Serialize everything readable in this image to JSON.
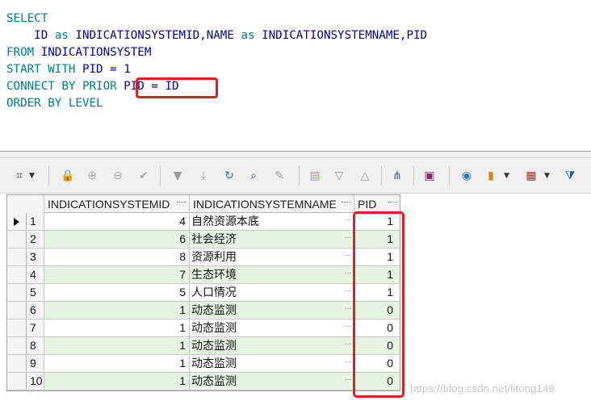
{
  "editor": {
    "lines": [
      {
        "parts": [
          {
            "t": "SELECT",
            "k": "kw"
          }
        ]
      },
      {
        "parts": [
          {
            "t": "    ",
            "k": "str"
          },
          {
            "t": "ID",
            "k": "str"
          },
          {
            "t": " as ",
            "k": "kw"
          },
          {
            "t": "INDICATIONSYSTEMID,NAME",
            "k": "str"
          },
          {
            "t": " as ",
            "k": "kw"
          },
          {
            "t": "INDICATIONSYSTEMNAME,PID",
            "k": "str"
          }
        ]
      },
      {
        "parts": [
          {
            "t": "FROM ",
            "k": "kw"
          },
          {
            "t": "INDICATIONSYSTEM",
            "k": "str"
          }
        ]
      },
      {
        "parts": [
          {
            "t": "START WITH ",
            "k": "kw"
          },
          {
            "t": "PID = 1",
            "k": "str"
          }
        ]
      },
      {
        "parts": [
          {
            "t": "CONNECT BY PRIOR ",
            "k": "kw"
          },
          {
            "t": "PID = ID",
            "k": "str"
          }
        ]
      },
      {
        "parts": [
          {
            "t": "ORDER BY LEVEL",
            "k": "kw"
          }
        ]
      }
    ]
  },
  "toolbar": {
    "icons": [
      {
        "name": "grid-settings-icon",
        "glyph": "⌗",
        "color": "#444444"
      },
      {
        "name": "lock-icon",
        "glyph": "🔒",
        "color": "#b02020"
      },
      {
        "name": "insert-record-icon",
        "glyph": "⊕",
        "color": "#aaaaaa"
      },
      {
        "name": "delete-record-icon",
        "glyph": "⊖",
        "color": "#aaaaaa"
      },
      {
        "name": "post-changes-icon",
        "glyph": "✔",
        "color": "#aaaaaa"
      },
      {
        "name": "filter-down-icon",
        "glyph": "▼",
        "color": "#999999"
      },
      {
        "name": "filter-last-icon",
        "glyph": "⤓",
        "color": "#999999"
      },
      {
        "name": "refresh-icon",
        "glyph": "↻",
        "color": "#2a6bc2"
      },
      {
        "name": "binoculars-icon",
        "glyph": "⌕",
        "color": "#2a4c8c"
      },
      {
        "name": "eraser-icon",
        "glyph": "✎",
        "color": "#999999"
      },
      {
        "name": "export-icon",
        "glyph": "▤",
        "color": "#d4a017"
      },
      {
        "name": "sort-down-icon",
        "glyph": "▽",
        "color": "#999999"
      },
      {
        "name": "sort-up-icon",
        "glyph": "△",
        "color": "#999999"
      },
      {
        "name": "tree-view-icon",
        "glyph": "⋔",
        "color": "#3a5a9a"
      },
      {
        "name": "save-icon",
        "glyph": "▣",
        "color": "#8a2a6a"
      },
      {
        "name": "query-info-icon",
        "glyph": "◉",
        "color": "#2a7ac2"
      },
      {
        "name": "chart-icon",
        "glyph": "▮",
        "color": "#d48a17"
      },
      {
        "name": "table-view-icon",
        "glyph": "▦",
        "color": "#c02030"
      },
      {
        "name": "funnel-icon",
        "glyph": "⧩",
        "color": "#1a5ab2"
      }
    ]
  },
  "grid": {
    "columns": [
      "INDICATIONSYSTEMID",
      "INDICATIONSYSTEMNAME",
      "PID"
    ],
    "rows": [
      {
        "n": "1",
        "id": "4",
        "name": "自然资源本底",
        "pid": "1"
      },
      {
        "n": "2",
        "id": "6",
        "name": "社会经济",
        "pid": "1"
      },
      {
        "n": "3",
        "id": "8",
        "name": "资源利用",
        "pid": "1"
      },
      {
        "n": "4",
        "id": "7",
        "name": "生态环境",
        "pid": "1"
      },
      {
        "n": "5",
        "id": "5",
        "name": "人口情况",
        "pid": "1"
      },
      {
        "n": "6",
        "id": "1",
        "name": "动态监测",
        "pid": "0"
      },
      {
        "n": "7",
        "id": "1",
        "name": "动态监测",
        "pid": "0"
      },
      {
        "n": "8",
        "id": "1",
        "name": "动态监测",
        "pid": "0"
      },
      {
        "n": "9",
        "id": "1",
        "name": "动态监测",
        "pid": "0"
      },
      {
        "n": "10",
        "id": "1",
        "name": "动态监测",
        "pid": "0"
      }
    ],
    "cell_ellipsis": "..."
  },
  "watermark": "https://blog.csdn.net/litong149",
  "colors": {
    "annotation": "#e02020",
    "row_alt": "#e6f5e1"
  }
}
